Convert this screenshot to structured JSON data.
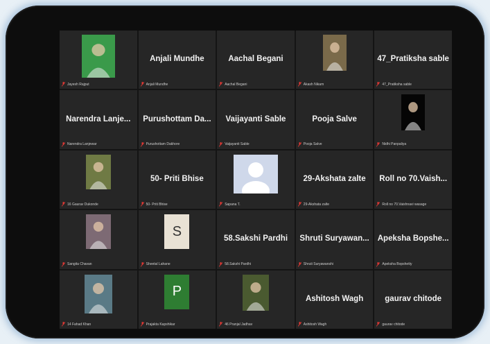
{
  "participants": [
    {
      "display": "",
      "label": "Jayesh Rajput",
      "avatar": "photo-young-man-white-shirt",
      "av": {
        "w": 48,
        "h": 62,
        "bg": "#3a9a4a"
      }
    },
    {
      "display": "Anjali Mundhe",
      "label": "Anjali Mundhe"
    },
    {
      "display": "Aachal Begani",
      "label": "Aachal Begani"
    },
    {
      "display": "",
      "label": "Akash Nikam",
      "avatar": "photo-man-outdoors",
      "av": {
        "w": 34,
        "h": 52,
        "bg": "#7a6a4a"
      }
    },
    {
      "display": "47_Pratiksha sable",
      "label": "47_Pratiksha sable"
    },
    {
      "display": "Narendra Lanje...",
      "label": "Narendra Lanjewar"
    },
    {
      "display": "Purushottam Da...",
      "label": "Purushottam Dakhore"
    },
    {
      "display": "Vaijayanti Sable",
      "label": "Vaijayanti Sable"
    },
    {
      "display": "Pooja Salve",
      "label": "Pooja Salve"
    },
    {
      "display": "",
      "label": "Nidhi Panpaliya",
      "avatar": "dark-abstract-image",
      "av": {
        "w": 34,
        "h": 52,
        "bg": "#050505"
      }
    },
    {
      "display": "",
      "label": "16 Gaurav Dukonde",
      "avatar": "photo-person-with-flowers",
      "av": {
        "w": 36,
        "h": 50,
        "bg": "#6f7a44"
      }
    },
    {
      "display": "50- Priti Bhise",
      "label": "50- Priti Bhise"
    },
    {
      "display": "",
      "label": "Sapana T.",
      "avatar": "default-profile-silhouette",
      "av": {
        "w": 64,
        "h": 56,
        "bg": "#cfd8ea"
      }
    },
    {
      "display": "29-Akshata zalte",
      "label": "29-Akshata zalte"
    },
    {
      "display": "Roll no 70.Vaish...",
      "label": "Roll no 70.Vaishnavi wasage"
    },
    {
      "display": "",
      "label": "Sangita Chavan",
      "avatar": "photo-woman-portrait",
      "av": {
        "w": 36,
        "h": 50,
        "bg": "#7d6a74"
      }
    },
    {
      "display": "",
      "label": "Sheetal Lahane",
      "avatar": "letter-tile",
      "letter": "S",
      "av": {
        "w": 36,
        "h": 50,
        "bg": "#e9e2d5"
      },
      "lcolor": "#333333"
    },
    {
      "display": "58.Sakshi Pardhi",
      "label": "58.Sakshi Pardhi"
    },
    {
      "display": "Shruti Suryawan...",
      "label": "Shruti Suryawanshi"
    },
    {
      "display": "Apeksha Bopshe...",
      "label": "Apeksha Bopshetty"
    },
    {
      "display": "",
      "label": "14 Fahad Khan",
      "avatar": "photo-young-man",
      "av": {
        "w": 40,
        "h": 56,
        "bg": "#5a7a86"
      }
    },
    {
      "display": "",
      "label": "Prajakta Kapshikar",
      "avatar": "letter-tile",
      "letter": "P",
      "av": {
        "w": 36,
        "h": 50,
        "bg": "#2e7d32"
      },
      "lcolor": "#ffffff"
    },
    {
      "display": "",
      "label": "46 Pranjal Jadhav",
      "avatar": "photo-nature-leaves",
      "av": {
        "w": 38,
        "h": 52,
        "bg": "#4a5a30"
      }
    },
    {
      "display": "Ashitosh Wagh",
      "label": "Ashitosh Wagh"
    },
    {
      "display": "gaurav chitode",
      "label": "gaurav chitode"
    }
  ],
  "colors": {
    "mic_muted": "#e53935",
    "tile": "#262626",
    "frame": "#0d0d0d"
  }
}
